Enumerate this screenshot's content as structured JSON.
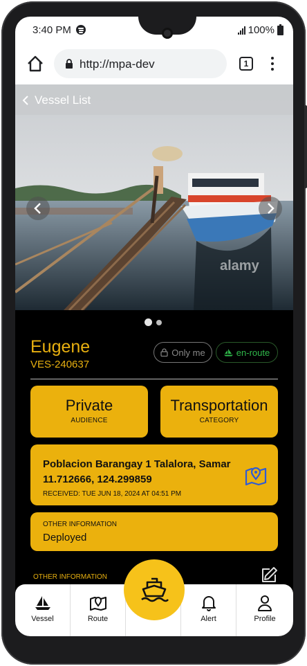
{
  "status_bar": {
    "time": "3:40 PM",
    "battery": "100%"
  },
  "browser": {
    "url": "http://mpa-dev",
    "tab_count": "1"
  },
  "header": {
    "back_label": "Vessel List"
  },
  "vessel": {
    "name": "Eugene",
    "id": "VES-240637",
    "visibility": "Only me",
    "status": "en-route"
  },
  "cards": {
    "audience": {
      "value": "Private",
      "label": "AUDIENCE"
    },
    "category": {
      "value": "Transportation",
      "label": "CATEGORY"
    },
    "location": {
      "address": "Poblacion Barangay 1 Talalora, Samar",
      "coords": "11.712666, 124.299859",
      "received": "RECEIVED: TUE JUN 18, 2024 AT 04:51 PM"
    },
    "other": {
      "label": "OTHER INFORMATION",
      "value": "Deployed"
    }
  },
  "section": {
    "other_info_label": "OTHER INFORMATION"
  },
  "watermark": "alamy",
  "bottom_nav": {
    "items": [
      {
        "label": "Vessel",
        "icon": "sailboat-icon"
      },
      {
        "label": "Route",
        "icon": "map-pin-icon"
      },
      {
        "label": "",
        "icon": "ship-icon"
      },
      {
        "label": "Alert",
        "icon": "bell-icon"
      },
      {
        "label": "Profile",
        "icon": "user-icon"
      }
    ]
  },
  "colors": {
    "accent": "#ebb10d",
    "text_accent": "#e8b010",
    "status_green": "#2fb84a",
    "background": "#000000"
  }
}
